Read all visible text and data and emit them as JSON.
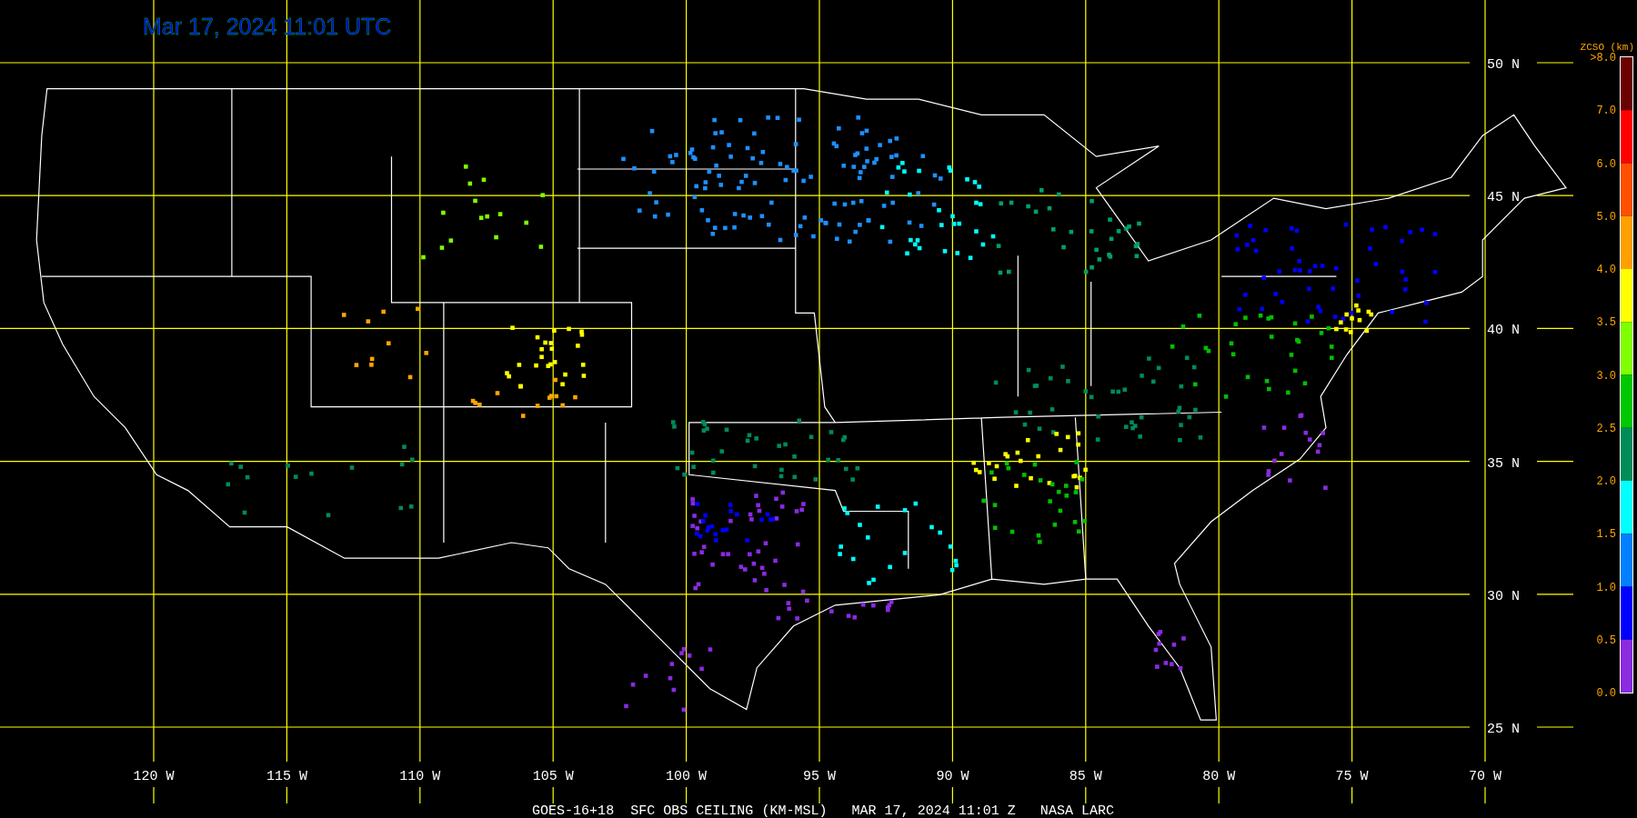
{
  "title": "Mar 17, 2024 11:01 UTC",
  "latitude_labels": [
    "50 N",
    "45 N",
    "40 N",
    "35 N",
    "30 N",
    "25 N"
  ],
  "longitude_labels": [
    "120 W",
    "115 W",
    "110 W",
    "105 W",
    "100 W",
    "95 W",
    "90 W",
    "85 W",
    "80 W",
    "75 W",
    "70 W"
  ],
  "legend": {
    "title": "ZCSO (km)",
    "labels": [
      ">8.0",
      "7.0",
      "6.0",
      "5.0",
      "4.0",
      "3.5",
      "3.0",
      "2.5",
      "2.0",
      "1.5",
      "1.0",
      "0.5",
      "0.0"
    ],
    "segments": [
      {
        "color": "#6b0000"
      },
      {
        "color": "#ff0000"
      },
      {
        "color": "#ff5000"
      },
      {
        "color": "#ffa000"
      },
      {
        "color": "#ffff00"
      },
      {
        "color": "#80ff00"
      },
      {
        "color": "#00c800"
      },
      {
        "color": "#008c5a"
      },
      {
        "color": "#00ffff"
      },
      {
        "color": "#0080ff"
      },
      {
        "color": "#0000ff"
      },
      {
        "color": "#8a2be2"
      }
    ]
  },
  "caption": "GOES-16+18  SFC OBS CEILING (KM-MSL)   MAR 17, 2024 11:01 Z   NASA LARC"
}
